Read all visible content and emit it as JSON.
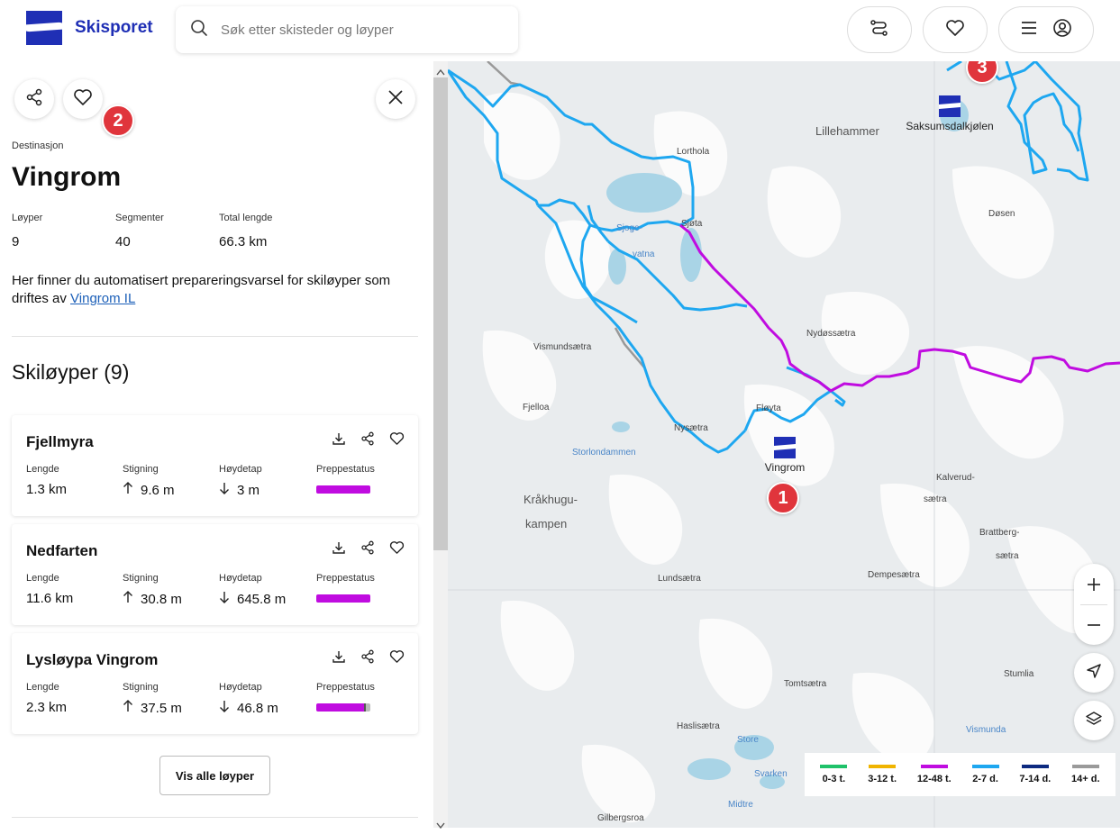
{
  "header": {
    "brand": "Skisporet",
    "search_placeholder": "Søk etter skisteder og løyper"
  },
  "panel": {
    "eyebrow": "Destinasjon",
    "title": "Vingrom",
    "stats": [
      {
        "label": "Løyper",
        "value": "9"
      },
      {
        "label": "Segmenter",
        "value": "40"
      },
      {
        "label": "Total lengde",
        "value": "66.3 km"
      }
    ],
    "description_text": "Her finner du automatisert prepareringsvarsel for skiløyper som driftes av",
    "description_link": "Vingrom IL",
    "section_title": "Skiløyper (9)",
    "labels": {
      "length": "Lengde",
      "climb": "Stigning",
      "drop": "Høydetap",
      "prep": "Preppestatus"
    },
    "trails": [
      {
        "name": "Fjellmyra",
        "length": "1.3 km",
        "climb": "9.6 m",
        "drop": "3 m",
        "prep_color": "#c00ce0",
        "prep_fill": 1.0
      },
      {
        "name": "Nedfarten",
        "length": "11.6 km",
        "climb": "30.8 m",
        "drop": "645.8 m",
        "prep_color": "#c00ce0",
        "prep_fill": 1.0
      },
      {
        "name": "Lysløypa Vingrom",
        "length": "2.3 km",
        "climb": "37.5 m",
        "drop": "46.8 m",
        "prep_color": "#c00ce0",
        "prep_fill": 0.88
      }
    ],
    "more_button": "Vis alle løyper"
  },
  "badges": [
    "1",
    "2",
    "3"
  ],
  "map": {
    "places": [
      "Lillehammer",
      "Lorthola",
      "Sjøta",
      "Døsen",
      "Nydøssætra",
      "Vismundsætra",
      "Fjelloa",
      "Fløyta",
      "Nysætra",
      "Kalverud-",
      "sætra",
      "Kråkhugu-",
      "kampen",
      "Brattberg-",
      "sætra",
      "Lundsætra",
      "Dempesætra",
      "Tomtsætra",
      "Stumlia",
      "Haslisætra",
      "Gilbergsroa"
    ],
    "water": [
      "Sjoge-",
      "vatna",
      "Storlondammen",
      "Store",
      "Svarken",
      "Midtre",
      "Vismunda"
    ],
    "pois": [
      {
        "name": "Saksumsdalkjølen"
      },
      {
        "name": "Vingrom"
      }
    ]
  },
  "legend": [
    {
      "label": "0-3 t.",
      "color": "#1fc26a"
    },
    {
      "label": "3-12 t.",
      "color": "#f0b400"
    },
    {
      "label": "12-48 t.",
      "color": "#c00ce0"
    },
    {
      "label": "2-7 d.",
      "color": "#1ea7f0"
    },
    {
      "label": "7-14 d.",
      "color": "#0d2a80"
    },
    {
      "label": "14+ d.",
      "color": "#9a9a9a"
    }
  ]
}
